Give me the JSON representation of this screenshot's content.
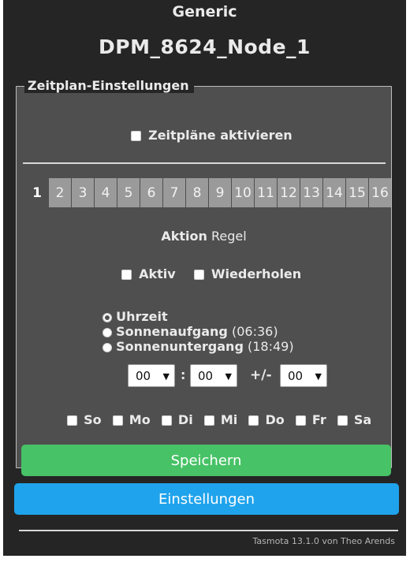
{
  "header": {
    "module": "Generic",
    "device": "DPM_8624_Node_1"
  },
  "schedule": {
    "legend": "Zeitplan-Einstellungen",
    "enable_label": "Zeitpläne aktivieren",
    "tabs": [
      "1",
      "2",
      "3",
      "4",
      "5",
      "6",
      "7",
      "8",
      "9",
      "10",
      "11",
      "12",
      "13",
      "14",
      "15",
      "16"
    ],
    "action_label": "Aktion",
    "action_value": "Regel",
    "active_label": "Aktiv",
    "repeat_label": "Wiederholen",
    "mode": {
      "time": "Uhrzeit",
      "sunrise": "Sonnenaufgang",
      "sunrise_time": "(06:36)",
      "sunset": "Sonnenuntergang",
      "sunset_time": "(18:49)"
    },
    "time": {
      "hour": "00",
      "separator": ":",
      "minute": "00",
      "offset_label": "+/-",
      "offset": "00"
    },
    "days": [
      "So",
      "Mo",
      "Di",
      "Mi",
      "Do",
      "Fr",
      "Sa"
    ],
    "save_label": "Speichern"
  },
  "settings_label": "Einstellungen",
  "footer": "Tasmota 13.1.0 von Theo Arends",
  "colors": {
    "background": "#252525",
    "panel": "#4f4f4f",
    "tab": "#9a9a9a",
    "save_button": "#47c266",
    "settings_button": "#1fa3ec"
  }
}
